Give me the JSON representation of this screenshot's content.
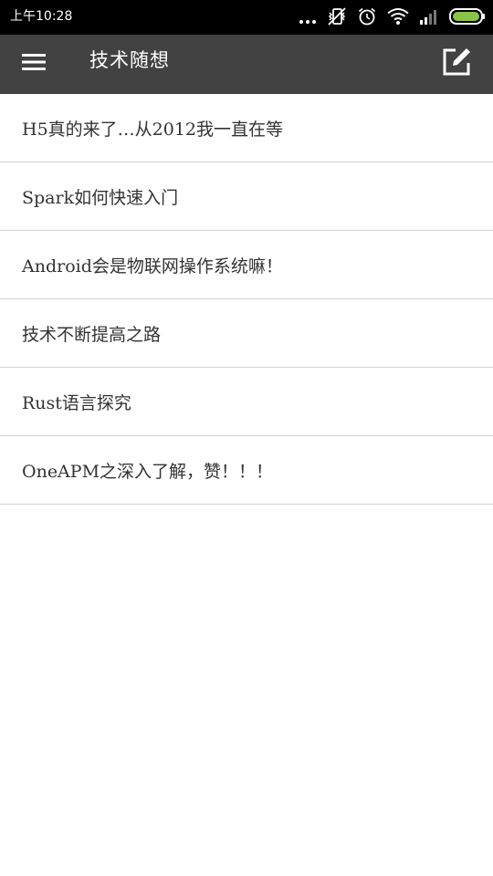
{
  "status_bar": {
    "time": "上午10:28",
    "icons": [
      "more-dots-icon",
      "vibrate-off-icon",
      "alarm-icon",
      "wifi-icon",
      "cell-signal-icon",
      "battery-icon"
    ]
  },
  "app_bar": {
    "title": "技术随想",
    "menu_icon": "hamburger-menu-icon",
    "edit_icon": "edit-compose-icon"
  },
  "list": {
    "items": [
      {
        "label": "H5真的来了…从2012我一直在等"
      },
      {
        "label": "Spark如何快速入门"
      },
      {
        "label": "Android会是物联网操作系统嘛！"
      },
      {
        "label": "技术不断提高之路"
      },
      {
        "label": "Rust语言探究"
      },
      {
        "label": "OneAPM之深入了解，赞！！！"
      }
    ]
  },
  "colors": {
    "status_bar_bg": "#000000",
    "app_bar_bg": "#424242",
    "divider": "#d2d2d2",
    "text": "#333333",
    "battery_fill": "#8bc34a"
  }
}
